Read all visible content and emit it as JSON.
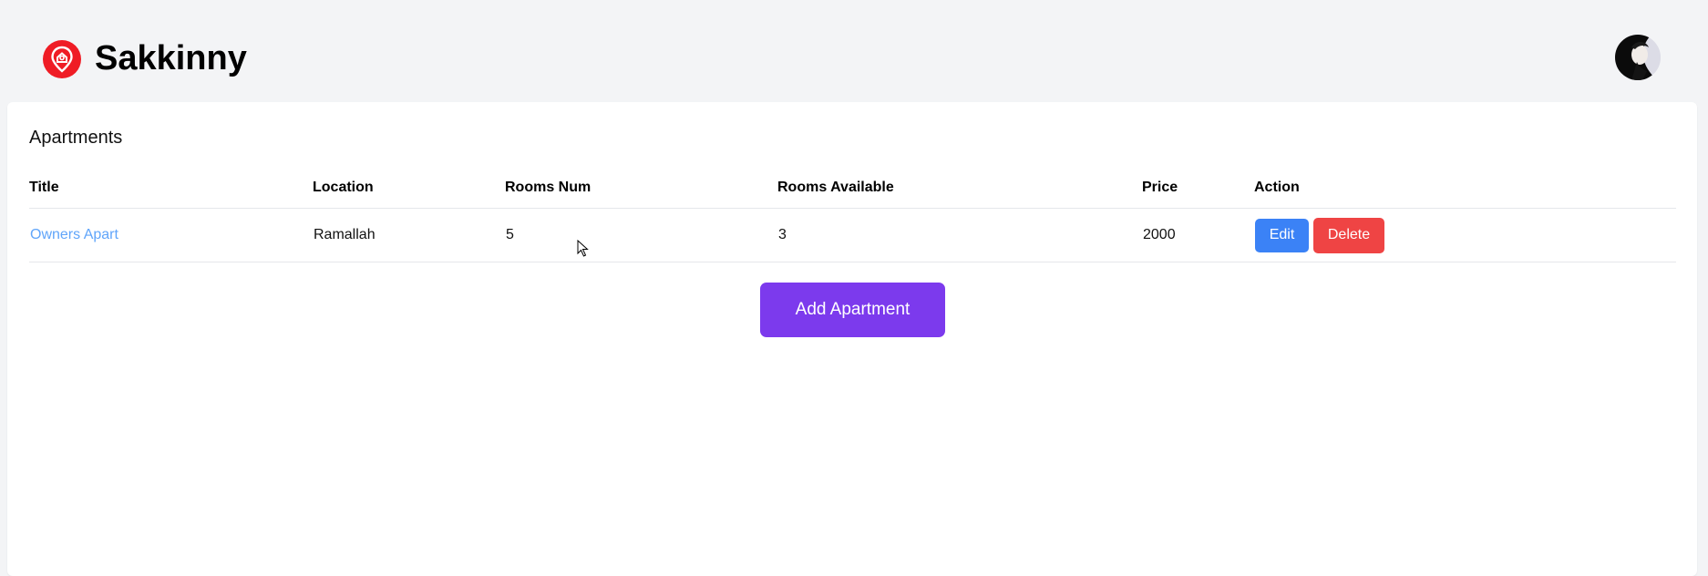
{
  "app": {
    "brand_name": "Sakkinny",
    "logo_icon": "map-pin-home-icon",
    "avatar_icon": "user-avatar",
    "accent_color": "#ef1c25"
  },
  "panel": {
    "title": "Apartments"
  },
  "table": {
    "headers": [
      "Title",
      "Location",
      "Rooms Num",
      "Rooms Available",
      "Price",
      "Action"
    ],
    "rows": [
      {
        "title": "Owners Apart",
        "location": "Ramallah",
        "rooms_num": "5",
        "rooms_available": "3",
        "price": "2000",
        "edit_label": "Edit",
        "delete_label": "Delete"
      }
    ]
  },
  "actions": {
    "add_label": "Add Apartment"
  },
  "colors": {
    "edit": "#3b82f6",
    "delete": "#ef4444",
    "add": "#7c3aed",
    "link": "#60a5fa"
  }
}
